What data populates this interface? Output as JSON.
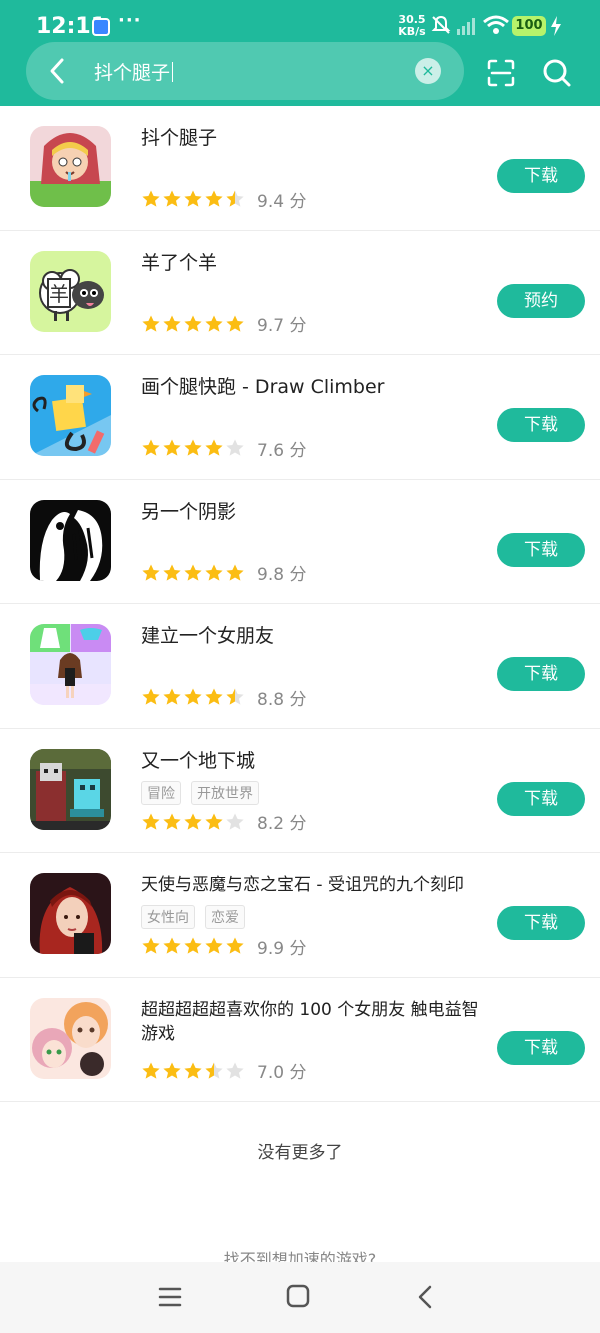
{
  "status_bar": {
    "time": "12:11",
    "dots": "···",
    "net_speed_value": "30.5",
    "net_speed_unit": "KB/s",
    "battery": "100"
  },
  "search": {
    "query": "抖个腿子",
    "clear": "×"
  },
  "colors": {
    "accent": "#1fba9c",
    "star": "#fbbd13",
    "star_empty": "#e2e2e2"
  },
  "apps": [
    {
      "title": "抖个腿子",
      "rating": 9.4,
      "score": "9.4 分",
      "button": "下载",
      "tags": []
    },
    {
      "title": "羊了个羊",
      "rating": 9.7,
      "score": "9.7 分",
      "button": "预约",
      "tags": []
    },
    {
      "title": "画个腿快跑 - Draw Climber",
      "rating": 7.6,
      "score": "7.6 分",
      "button": "下载",
      "tags": []
    },
    {
      "title": "另一个阴影",
      "rating": 9.8,
      "score": "9.8 分",
      "button": "下载",
      "tags": []
    },
    {
      "title": "建立一个女朋友",
      "rating": 8.8,
      "score": "8.8 分",
      "button": "下载",
      "tags": []
    },
    {
      "title": "又一个地下城",
      "rating": 8.2,
      "score": "8.2 分",
      "button": "下载",
      "tags": [
        "冒险",
        "开放世界"
      ]
    },
    {
      "title": "天使与恶魔与恋之宝石 - 受诅咒的九个刻印",
      "rating": 9.9,
      "score": "9.9 分",
      "button": "下载",
      "tags": [
        "女性向",
        "恋爱"
      ]
    },
    {
      "title": "超超超超超喜欢你的 100 个女朋友 触电益智游戏",
      "rating": 7.0,
      "score": "7.0 分",
      "button": "下载",
      "tags": []
    }
  ],
  "footer": {
    "no_more": "没有更多了",
    "not_found": "找不到想加速的游戏?"
  }
}
